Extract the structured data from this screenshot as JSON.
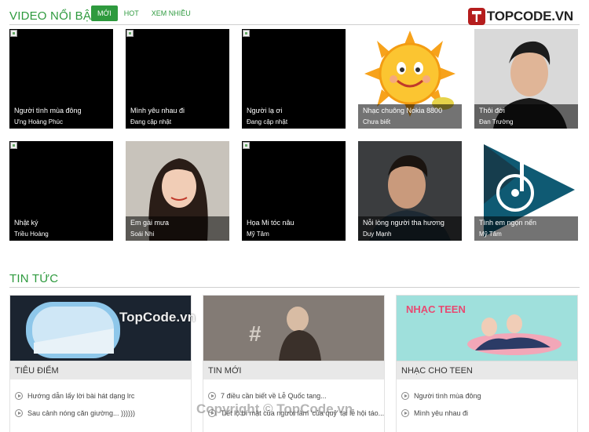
{
  "video_section": {
    "title": "VIDEO NỔI BẬT",
    "tabs": [
      {
        "label": "MỚI",
        "active": true
      },
      {
        "label": "HOT",
        "active": false
      },
      {
        "label": "XEM NHIỀU",
        "active": false
      }
    ],
    "videos": [
      {
        "name": "Người tình mùa đông",
        "artist": "Ưng Hoàng Phúc",
        "image": "broken"
      },
      {
        "name": "Mình yêu nhau đi",
        "artist": "Đang cập nhật",
        "image": "broken"
      },
      {
        "name": "Người lạ ơi",
        "artist": "Đang cập nhật",
        "image": "broken"
      },
      {
        "name": "Nhạc chuông Nokia 8800",
        "artist": "Chưa biết",
        "image": "sun"
      },
      {
        "name": "Thôi đời",
        "artist": "Đan Trường",
        "image": "portrait-man"
      },
      {
        "name": "Nhật ký",
        "artist": "Triều Hoàng",
        "image": "broken"
      },
      {
        "name": "Em gái mưa",
        "artist": "Soái Nhi",
        "image": "portrait-girl"
      },
      {
        "name": "Họa Mi tóc nâu",
        "artist": "Mỹ Tâm",
        "image": "broken"
      },
      {
        "name": "Nỗi lòng người tha hương",
        "artist": "Duy Mạnh",
        "image": "portrait-man2"
      },
      {
        "name": "Tình em ngọn nến",
        "artist": "Mỹ Tâm",
        "image": "dj-logo"
      }
    ]
  },
  "logo": {
    "text": "TOPCODE.VN",
    "icon": "topcode-logo-icon"
  },
  "news_section": {
    "title": "TIN TỨC",
    "columns": [
      {
        "label": "TIÊU ĐIỂM",
        "image": "airplane-window",
        "items": [
          "Hướng dẫn lấy lời bài hát dạng lrc",
          "Sau cảnh nóng căn giường... ))))))"
        ]
      },
      {
        "label": "TIN MỚI",
        "image": "concert",
        "items": [
          "7 điều cần biết về Lễ Quốc tang...",
          "Tiết lộ bí mật của người làm 'của quỷ' tại lễ hội táo..."
        ]
      },
      {
        "label": "NHẠC CHO TEEN",
        "image": "nhac-teen",
        "items": [
          "Người tình mùa đông",
          "Mình yêu nhau đi"
        ]
      }
    ],
    "teen_banner_text": "NHẠC TEEN"
  },
  "watermarks": {
    "top": "TopCode.vn",
    "bottom": "Copyright © TopCode.vn"
  },
  "colors": {
    "accent": "#2e9a3e",
    "logo_red": "#b51d1d"
  }
}
